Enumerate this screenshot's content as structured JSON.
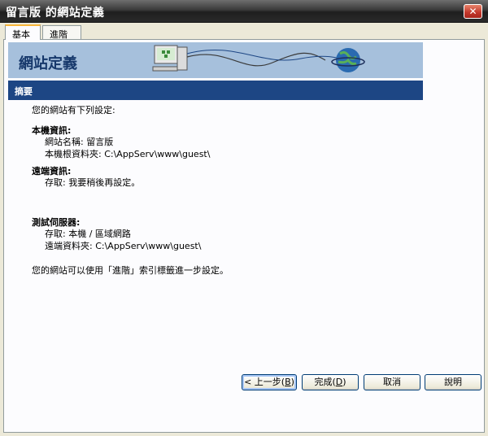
{
  "window": {
    "title": "留言版 的網站定義",
    "close_label": "✕"
  },
  "tabs": [
    {
      "label": "基本",
      "active": true
    },
    {
      "label": "進階",
      "active": false
    }
  ],
  "banner": {
    "title": "網站定義"
  },
  "section": {
    "title": "摘要"
  },
  "summary": {
    "intro": "您的網站有下列設定:",
    "local_heading": "本機資訊:",
    "local_site_name": "網站名稱: 留言版",
    "local_root": "本機根資料夾: C:\\AppServ\\www\\guest\\",
    "remote_heading": "遠端資訊:",
    "remote_access": "存取: 我要稍後再設定。",
    "test_heading": "測試伺服器:",
    "test_access": "存取: 本機 / 區域網路",
    "test_remote_folder": "遠端資料夾: C:\\AppServ\\www\\guest\\",
    "footer_note": "您的網站可以使用「進階」索引標籤進一步設定。"
  },
  "buttons": {
    "back_prefix": "< 上一步(",
    "back_key": "B",
    "back_suffix": ")",
    "finish_prefix": "完成(",
    "finish_key": "D",
    "finish_suffix": ")",
    "cancel": "取消",
    "help": "說明"
  },
  "colors": {
    "section_bar": "#1d4684",
    "banner": "#a6c0dc",
    "title_bar": "#3a3a3a"
  }
}
